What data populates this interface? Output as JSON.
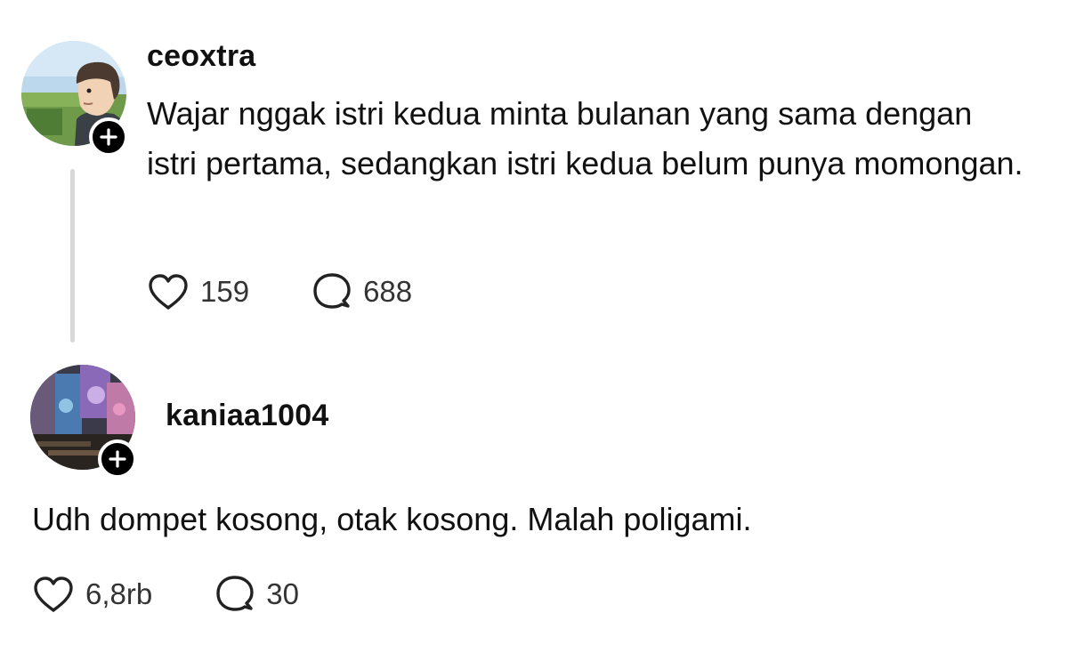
{
  "posts": [
    {
      "username": "ceoxtra",
      "text": "Wajar nggak istri kedua minta bulanan yang sama dengan istri pertama, sedangkan istri kedua belum punya momongan.",
      "likes": "159",
      "replies": "688"
    },
    {
      "username": "kaniaa1004",
      "text": "Udh dompet kosong, otak kosong. Malah poligami.",
      "likes": "6,8rb",
      "replies": "30"
    }
  ],
  "icons": {
    "like": "heart-icon",
    "reply": "comment-bubble-icon",
    "follow": "plus-icon"
  }
}
